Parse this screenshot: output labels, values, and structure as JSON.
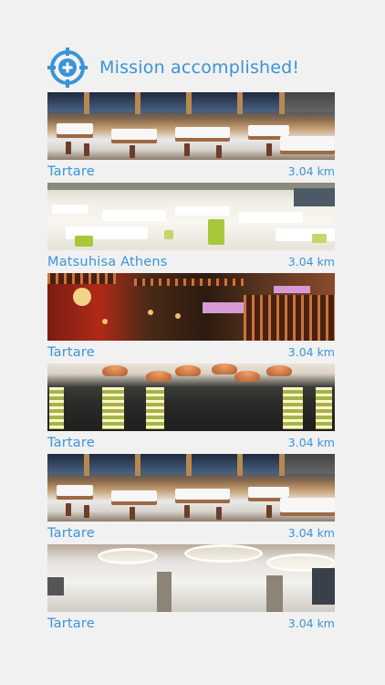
{
  "header": {
    "title": "Mission accomplished!",
    "icon": "target-crosshair-icon",
    "accent_color": "#3a94d6"
  },
  "restaurants": [
    {
      "name": "Tartare",
      "distance": "3.04 km"
    },
    {
      "name": "Matsuhisa Athens",
      "distance": "3.04 km"
    },
    {
      "name": "Tartare",
      "distance": "3.04 km"
    },
    {
      "name": "Tartare",
      "distance": "3.04 km"
    },
    {
      "name": "Tartare",
      "distance": "3.04 km"
    },
    {
      "name": "Tartare",
      "distance": "3.04 km"
    }
  ]
}
